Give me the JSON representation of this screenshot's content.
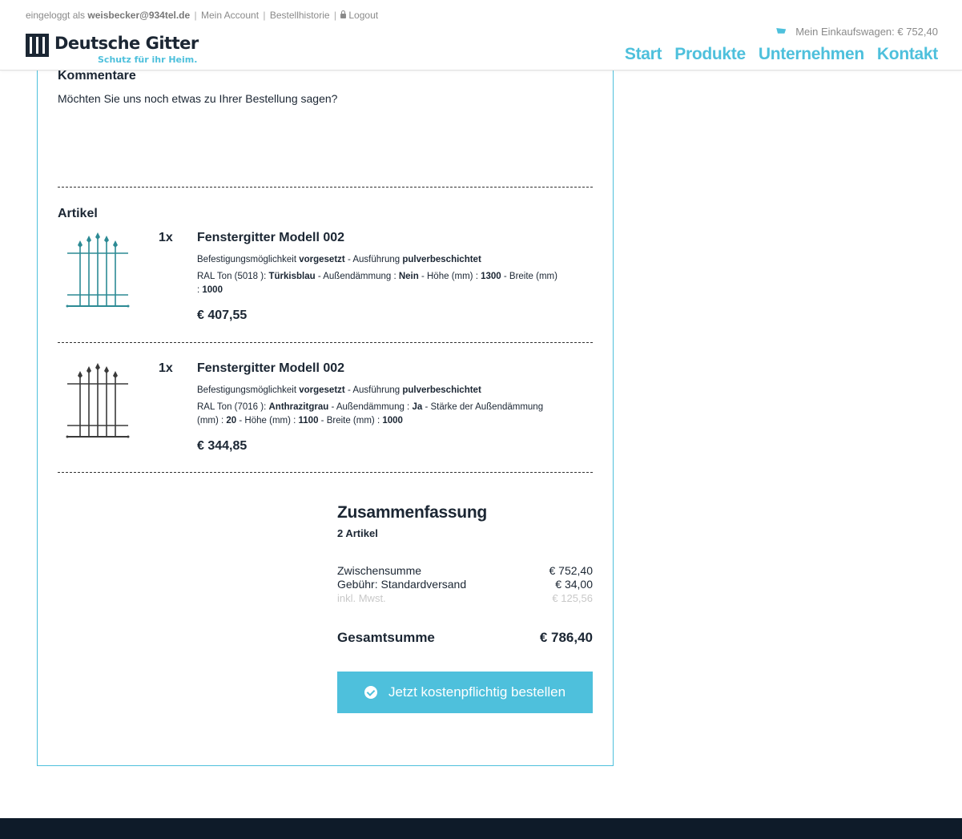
{
  "header": {
    "user_prefix": "eingeloggt als",
    "user_email": "weisbecker@934tel.de",
    "account_link": "Mein Account",
    "history_link": "Bestellhistorie",
    "logout_link": "Logout",
    "logo_name": "Deutsche Gitter",
    "logo_slogan": "Schutz für ihr Heim.",
    "cart_label": "Mein Einkaufswagen: € 752,40",
    "nav": [
      "Start",
      "Produkte",
      "Unternehmen",
      "Kontakt"
    ]
  },
  "comments": {
    "title": "Kommentare",
    "question": "Möchten Sie uns noch etwas zu Ihrer Bestellung sagen?"
  },
  "articles": {
    "title": "Artikel",
    "items": [
      {
        "qty": "1x",
        "name": "Fenstergitter Modell 002",
        "color": "#2c8a94",
        "line1_parts": [
          {
            "t": "Befestigungsmöglichkeit ",
            "b": false
          },
          {
            "t": "vorgesetzt",
            "b": true
          },
          {
            "t": " - Ausführung ",
            "b": false
          },
          {
            "t": "pulverbeschichtet",
            "b": true
          }
        ],
        "line2_parts": [
          {
            "t": "RAL Ton (5018 ): ",
            "b": false
          },
          {
            "t": "Türkisblau",
            "b": true
          },
          {
            "t": " - Außendämmung : ",
            "b": false
          },
          {
            "t": "Nein",
            "b": true
          },
          {
            "t": " - Höhe (mm) : ",
            "b": false
          },
          {
            "t": "1300",
            "b": true
          },
          {
            "t": " - Breite (mm) : ",
            "b": false
          },
          {
            "t": "1000",
            "b": true
          }
        ],
        "price": "€ 407,55"
      },
      {
        "qty": "1x",
        "name": "Fenstergitter Modell 002",
        "color": "#3a3a3a",
        "line1_parts": [
          {
            "t": "Befestigungsmöglichkeit ",
            "b": false
          },
          {
            "t": "vorgesetzt",
            "b": true
          },
          {
            "t": " - Ausführung ",
            "b": false
          },
          {
            "t": "pulverbeschichtet",
            "b": true
          }
        ],
        "line2_parts": [
          {
            "t": "RAL Ton (7016 ): ",
            "b": false
          },
          {
            "t": "Anthrazitgrau",
            "b": true
          },
          {
            "t": " - Außendämmung : ",
            "b": false
          },
          {
            "t": "Ja",
            "b": true
          },
          {
            "t": " - Stärke der Außendämmung (mm) : ",
            "b": false
          },
          {
            "t": "20",
            "b": true
          },
          {
            "t": " - Höhe (mm) : ",
            "b": false
          },
          {
            "t": "1100",
            "b": true
          },
          {
            "t": " - Breite (mm) : ",
            "b": false
          },
          {
            "t": "1000",
            "b": true
          }
        ],
        "price": "€ 344,85"
      }
    ]
  },
  "summary": {
    "title": "Zusammenfassung",
    "count": "2 Artikel",
    "subtotal_label": "Zwischensumme",
    "subtotal": "€ 752,40",
    "fee_label": "Gebühr: Standardversand",
    "fee": "€ 34,00",
    "tax_label": "inkl. Mwst.",
    "tax": "€ 125,56",
    "total_label": "Gesamtsumme",
    "total": "€ 786,40",
    "order_button": "Jetzt kostenpflichtig bestellen"
  },
  "colors": {
    "accent": "#4ec0dc",
    "dark": "#1b2633",
    "footer": "#0e1b29"
  }
}
